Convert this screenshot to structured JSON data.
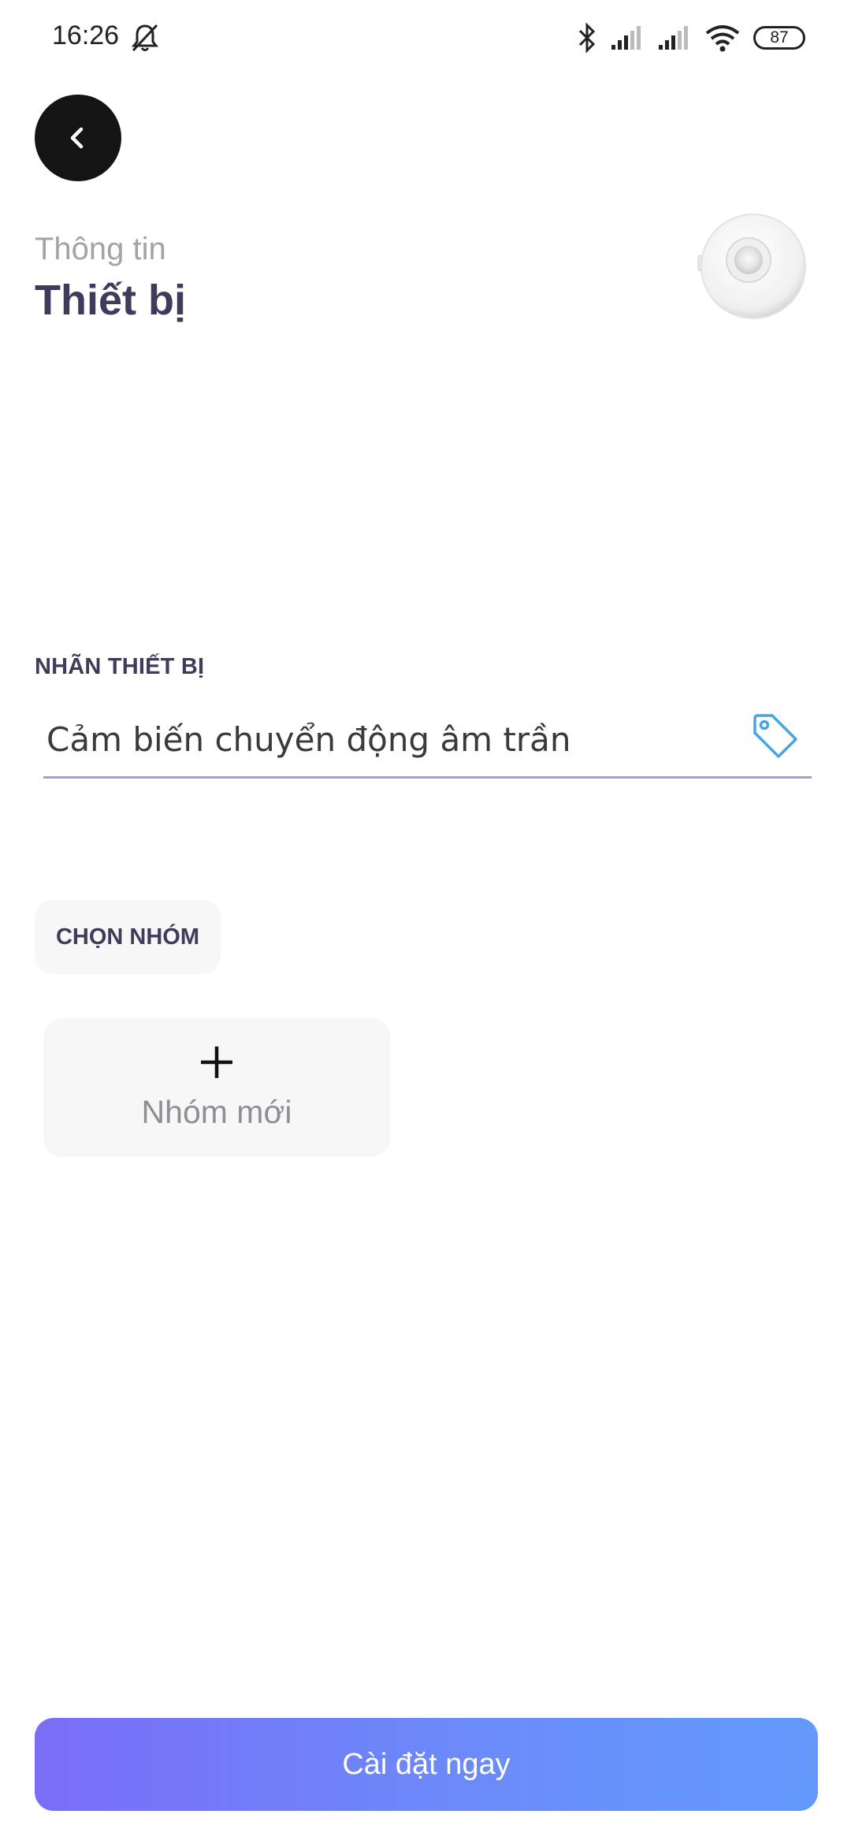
{
  "status_bar": {
    "time": "16:26",
    "battery": "87",
    "icons": [
      "mute-bell-icon",
      "bluetooth-icon",
      "signal-icon",
      "signal-icon",
      "wifi-icon",
      "battery-icon"
    ]
  },
  "header": {
    "subtitle": "Thông tin",
    "title": "Thiết bị",
    "back_icon": "chevron-left-icon",
    "device_image": "motion-sensor-device-image"
  },
  "label_section": {
    "heading": "NHÃN THIẾT BỊ",
    "value": "Cảm biến chuyển động âm trần",
    "icon": "tag-icon"
  },
  "group_section": {
    "chip_label": "CHỌN NHÓM",
    "new_group_label": "Nhóm mới",
    "new_group_icon": "plus-icon"
  },
  "footer": {
    "install_label": "Cài đặt ngay"
  },
  "colors": {
    "accent_start": "#7a6df7",
    "accent_end": "#6299fb",
    "title": "#3f3b5a",
    "muted": "#a3a1aa",
    "tag_icon": "#4aa3e0",
    "input_underline": "#a79fd8"
  }
}
